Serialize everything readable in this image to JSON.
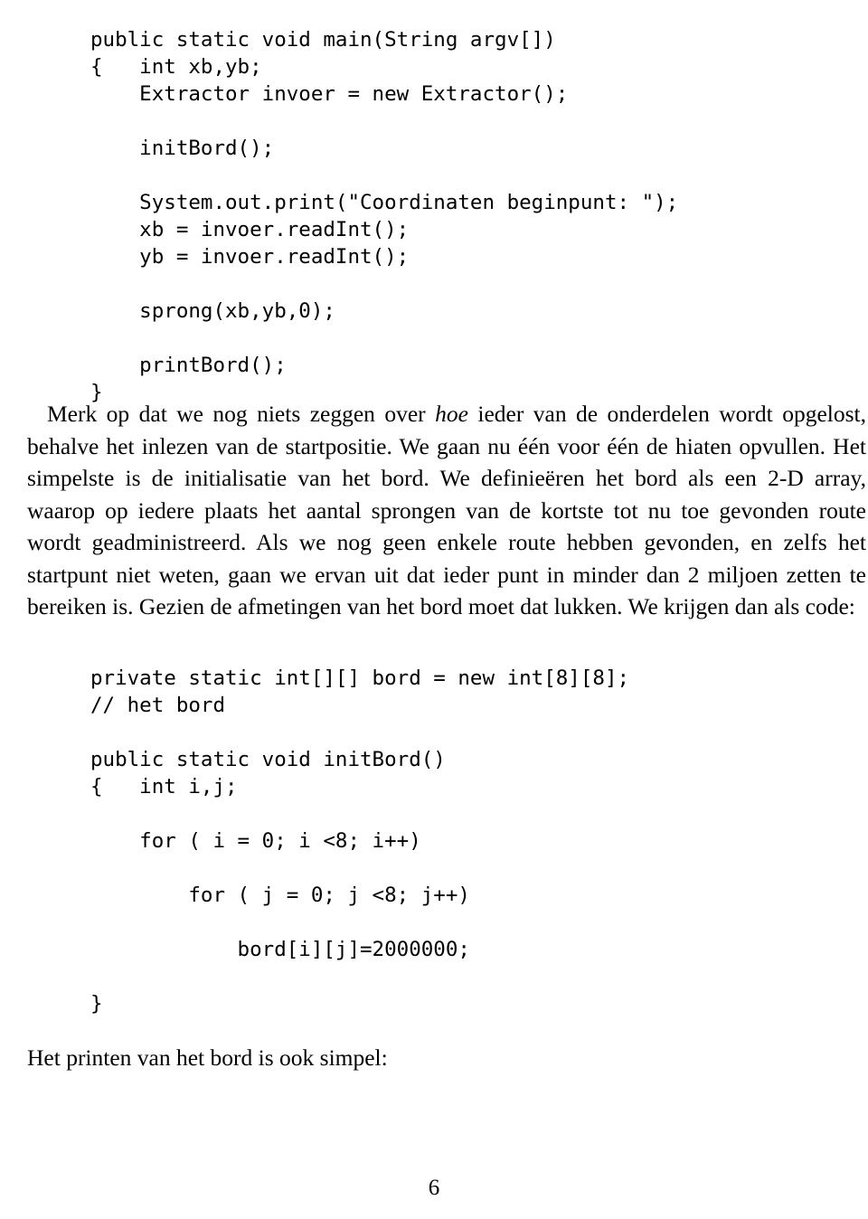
{
  "document": {
    "page_number": "6",
    "language": "nl"
  },
  "code_block_main": {
    "name": "main-method",
    "lines": [
      "public static void main(String argv[])",
      "{   int xb,yb;",
      "    Extractor invoer = new Extractor();",
      "",
      "    initBord();",
      "",
      "    System.out.print(\"Coordinaten beginpunt: \");",
      "    xb = invoer.readInt();",
      "    yb = invoer.readInt();",
      "",
      "    sprong(xb,yb,0);",
      "",
      "    printBord();",
      "}"
    ]
  },
  "code_block_init": {
    "name": "initbord-method",
    "lines": [
      "private static int[][] bord = new int[8][8];",
      "// het bord",
      "",
      "public static void initBord()",
      "{   int i,j;",
      "",
      "    for ( i = 0; i <8; i++)",
      "",
      "        for ( j = 0; j <8; j++)",
      "",
      "            bord[i][j]=2000000;",
      "",
      "}"
    ]
  },
  "prose_main": {
    "part1": "Merk op dat we nog niets zeggen over ",
    "emphasis": "hoe",
    "part2": " ieder van de onderdelen wordt opgelost, behalve het inlezen van de startpositie. We gaan nu één voor één de hiaten opvullen. Het simpelste is de initialisatie van het bord. We definieëren het bord als een 2-D array, waarop op iedere plaats het aantal sprongen van de kortste tot nu toe gevonden route wordt geadministreerd. Als we nog geen enkele route hebben gevonden, en zelfs het startpunt niet weten, gaan we ervan uit dat ieder punt in minder dan 2 miljoen zetten te bereiken is. Gezien de afmetingen van het bord moet dat lukken. We krijgen dan als code:"
  },
  "prose_tail": {
    "text": "Het printen van het bord is ook simpel:"
  }
}
